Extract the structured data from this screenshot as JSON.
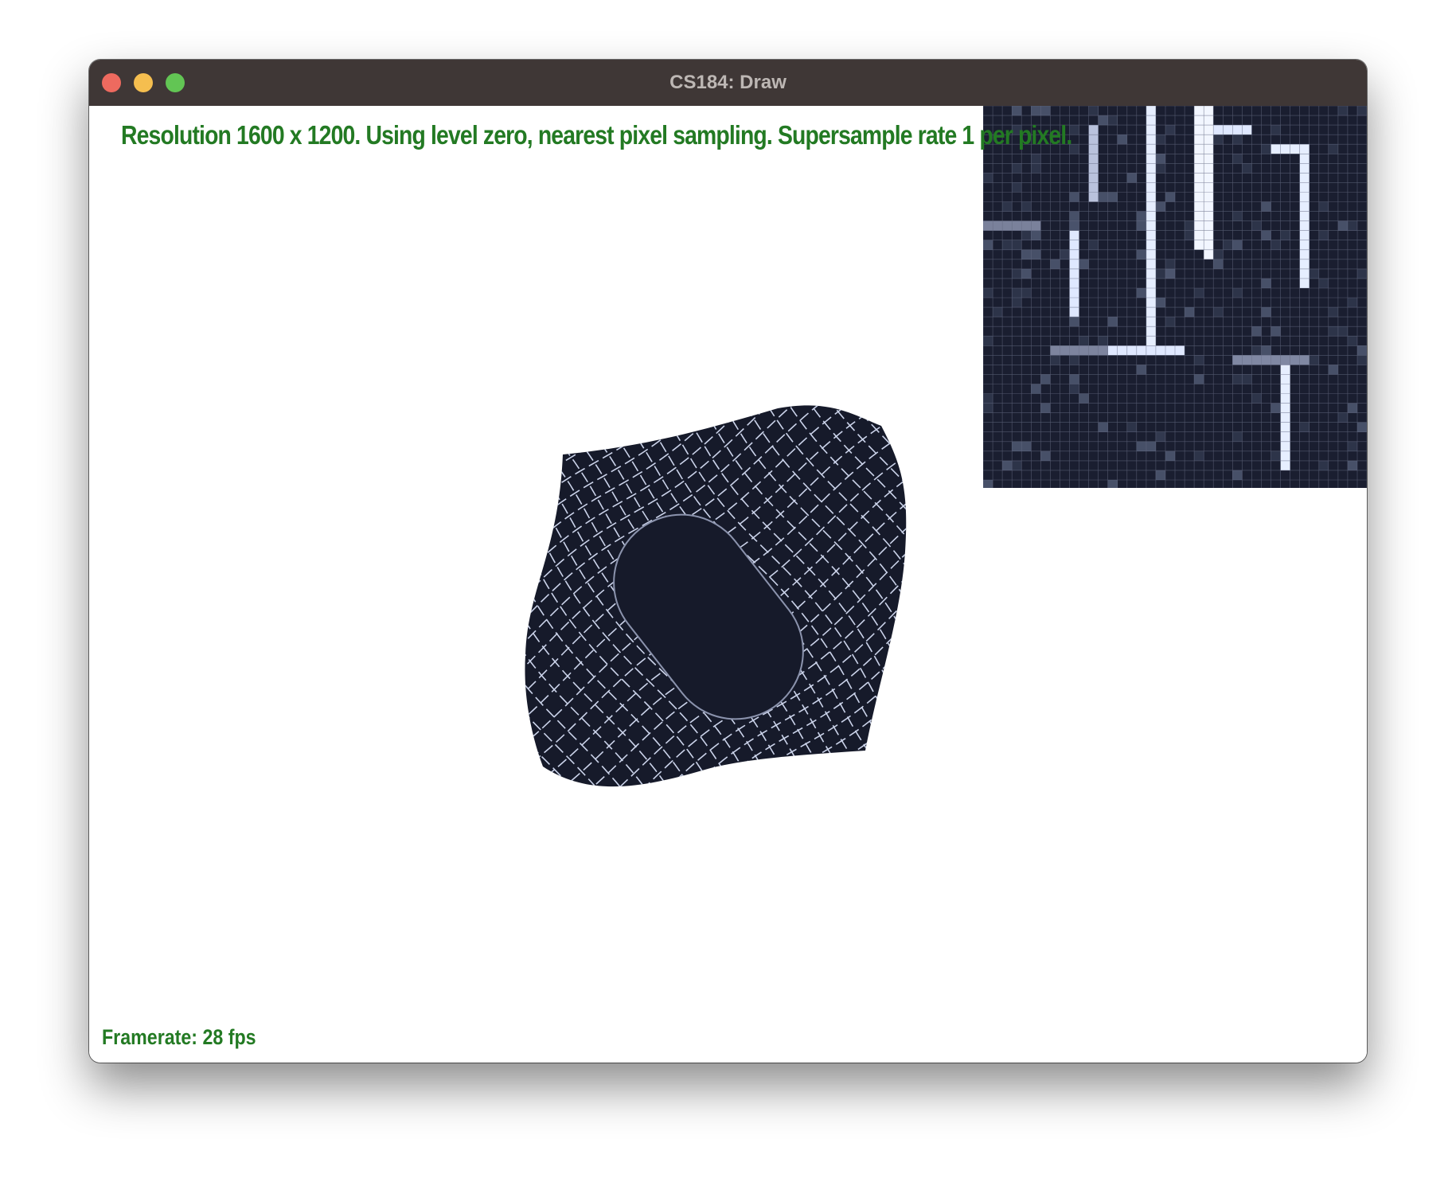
{
  "window": {
    "title": "CS184: Draw"
  },
  "traffic_lights": {
    "close_color": "#ee6a5f",
    "minimize_color": "#f5be4f",
    "zoom_color": "#62c554"
  },
  "hud": {
    "status_text": "Resolution 1600 x 1200. Using level zero, nearest pixel sampling. Supersample rate 1 per pixel.",
    "framerate_text": "Framerate: 28 fps",
    "text_color": "#237a23"
  },
  "canvas": {
    "background_color": "#ffffff",
    "texture_dark_color": "#161a2a",
    "texture_line_color": "#dfe8ff"
  }
}
